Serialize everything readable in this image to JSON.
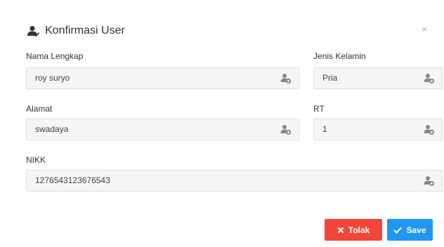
{
  "modal": {
    "title": "Konfirmasi User",
    "title_icon": "user-check-icon",
    "close_label": "×"
  },
  "fields": {
    "nama": {
      "label": "Nama Lengkap",
      "value": "roy suryo",
      "icon": "add-user-icon"
    },
    "jenis_kelamin": {
      "label": "Jenis Kelamin",
      "value": "Pria",
      "icon": "add-user-icon"
    },
    "alamat": {
      "label": "Alamat",
      "value": "swadaya",
      "icon": "add-user-icon"
    },
    "rt": {
      "label": "RT",
      "value": "1",
      "icon": "add-user-icon"
    },
    "nikk": {
      "label": "NIKK",
      "value": "1276543123676543",
      "icon": "add-user-icon"
    }
  },
  "buttons": {
    "tolak_label": "Tolak",
    "save_label": "Save"
  },
  "colors": {
    "tolak": "#f2453b",
    "save": "#2196f3"
  }
}
